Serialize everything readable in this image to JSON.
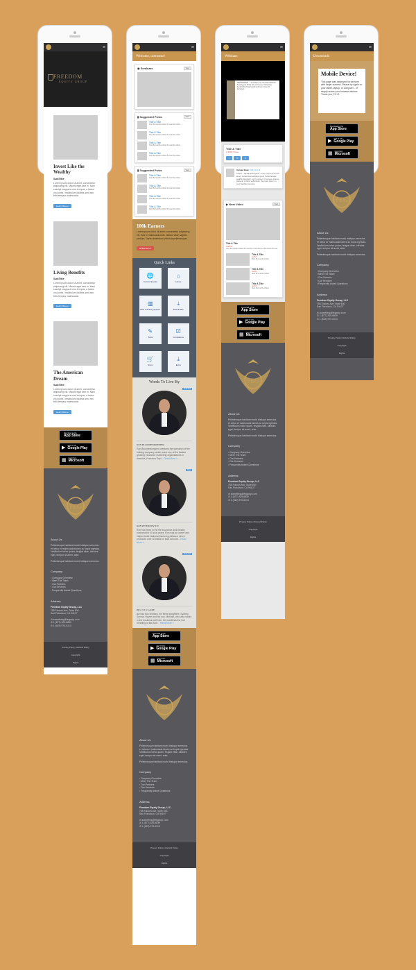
{
  "screens": {
    "home": {
      "hero": {
        "brand_line1": "FREEDOM",
        "brand_line2": "EQUITY GROUP"
      },
      "sections": [
        {
          "title": "Invest Like the Wealthy",
          "subtitle": "SubTitle",
          "text": "Lorem ipsum dolor sit amet, consectetur adipiscing elit. Mauris eget sem in. Nam suscipit magna a urna tempus, a luctus orci porta. Vestibulum facilisis sem nec felis tempus malesuada.",
          "button": "Learn More »"
        },
        {
          "title": "Living Benefits",
          "subtitle": "SubTitle",
          "text": "Lorem ipsum dolor sit amet, consectetur adipiscing elit. Mauris eget sem in. Nam suscipit magna a urna tempus, a luctus orci porta. Vestibulum facilisis sem nec felis tempus malesuada.",
          "button": "Learn More »"
        },
        {
          "title": "The American Dream",
          "subtitle": "SubTitle",
          "text": "Lorem ipsum dolor sit amet, consectetur adipiscing elit. Mauris eget sem in. Nam suscipit magna a urna tempus, a luctus orci porta. Vestibulum facilisis sem nec felis tempus malesuada.",
          "button": "Learn More »"
        }
      ]
    },
    "dashboard": {
      "welcome": "Welcome, username!",
      "seminars_title": "Seminars",
      "seminars_pill": "View",
      "suggested_title": "Suggested Posts",
      "suggested_pill": "View",
      "posts": [
        {
          "title": "Title & Title",
          "meta": "Matt Borstal BentMatt Borstal BentMatt ..."
        },
        {
          "title": "Title & Title",
          "meta": "Matt Borstal BentMatt Borstal BentMatt ..."
        },
        {
          "title": "Title & Title",
          "meta": "Matt Borstal BentMatt Borstal BentMatt ..."
        },
        {
          "title": "Title & Title",
          "meta": "Matt Borstal BentMatt Borstal BentMatt ..."
        }
      ],
      "earners_title": "100k Earners",
      "earners_text": "Lorem ipsum dolor sit amet, consectetur adipiscing elit. Sed in malesuada velit. Nullam vitae sagittis pretium. Donec bibendum vehicula pellentesque.",
      "earners_button": "All Earners »",
      "quick_links_title": "Quick Links",
      "quick_links": [
        {
          "label": "Current Events",
          "glyph": "🌐"
        },
        {
          "label": "Home",
          "glyph": "⌂"
        },
        {
          "label": "Elite Tracking System",
          "glyph": "▥"
        },
        {
          "label": "Downloads",
          "glyph": "⤓"
        },
        {
          "label": "Tools",
          "glyph": "✎"
        },
        {
          "label": "Compliance",
          "glyph": "☑"
        },
        {
          "label": "Store",
          "glyph": "🛒"
        },
        {
          "label": "Extra",
          "glyph": "⤓"
        }
      ],
      "words_title": "Words To Live By",
      "people": [
        {
          "name": "RON BLOOMENKREPPER",
          "tag": "Featured",
          "text": "Ron Bloomenkrepper oversees the operation of the holding company which owns one of the fastest growing insurance marketing organizations in America, Freedom Equi...",
          "more": "Read More »"
        },
        {
          "name": "RON PETERNOVICH",
          "tag": "New",
          "text": "Ron has been in the life insurance and annuity business for 30 plus years. Ron was an owner and helped build National Marketing Alliance which produced over 40 Billion in face amount...",
          "more": "Read More »"
        },
        {
          "name": "BILL ST. CLAIRE",
          "tag": "Featured",
          "text": "Bill has four children, his three daughters, Sydney, Sienna, Haven and his son, Michael, who also works in the business with him. He manifests the true meaning of the Ame...",
          "more": "Read More »"
        }
      ]
    },
    "webinars": {
      "bar": "Webinars",
      "panel_text": "WEB SEMINAR — No hidden fees. Recorded Webinar. Keeping your family safe and secure. Discussing benefits like living benefits and how to save for retirement.",
      "video_title": "Title & Title",
      "video_views": "2562 Views",
      "upload_label": "Upload Date:",
      "upload_date": "2017-10-11",
      "description": "Author - Global description. Lorem ipsum dolor sit amet, consectetur adipiscing elit. Pellentesque sagittis dignissim est in cursus. Ut congue mauris placerat porttitor sollicitudin. Sed quis ipsum in sem faucibus tempus.",
      "next_video": "Next Video",
      "next_pill": "View",
      "next_title": "Title & Title",
      "next_author": "Author",
      "next_meta": "Matt Borstal BentMatt Borstal Bent Matt Borstal BentMatt Borstal",
      "list": [
        {
          "title": "Title & Title",
          "author": "Author",
          "meta": "Matt Borstal BentMatt"
        },
        {
          "title": "Title & Title",
          "author": "Author",
          "meta": "Matt Borstal BentMatt"
        },
        {
          "title": "Title & Title",
          "author": "Author",
          "meta": "Matt Borstal BentMatt"
        }
      ]
    },
    "downloads": {
      "bar": "Downloads",
      "heading": "Mobile Device!",
      "text": "This page was optimized for devices with larger screens. Please try again on your tablet, laptop, or computer - or simply resize your browser window. Thank you, F.E.G."
    }
  },
  "stores": [
    {
      "small": "Download on the",
      "big": "App Store",
      "glyph": ""
    },
    {
      "small": "GET IT ON",
      "big": "Google Play",
      "glyph": "▶"
    },
    {
      "small": "Get it from",
      "big": "Microsoft",
      "glyph": "▦"
    }
  ],
  "footer": {
    "crest_letters": "FEG",
    "about_title": "About Us",
    "about_text": "Pellentesque habitant morbi tristique senectus et netus et malesuada fames ac turpis egestas. Vestibulum tortor quam, feugiat vitae, ultricies eget, tempor sit amet, ante.",
    "about_text2": "Pellentesque habitant morbi tristique senectus.",
    "company_title": "Company",
    "company_links": [
      "Company Overview",
      "Meet The Team",
      "Our Partners",
      "Our Services",
      "Frequently Asked Questions"
    ],
    "address_title": "Address",
    "address_lines": [
      "Freedom Equity Group, LLC",
      "755 Folsom Ave, Suite 600",
      "San Francisco, CA 94107"
    ],
    "contacts": [
      "something@fegcorp.com",
      "1 (877) 329-6839",
      "1 (619) 970-0213"
    ],
    "policy": "Privacy Policy  |  Refund Policy",
    "copyright": "Copyright",
    "rights": "Rights"
  }
}
